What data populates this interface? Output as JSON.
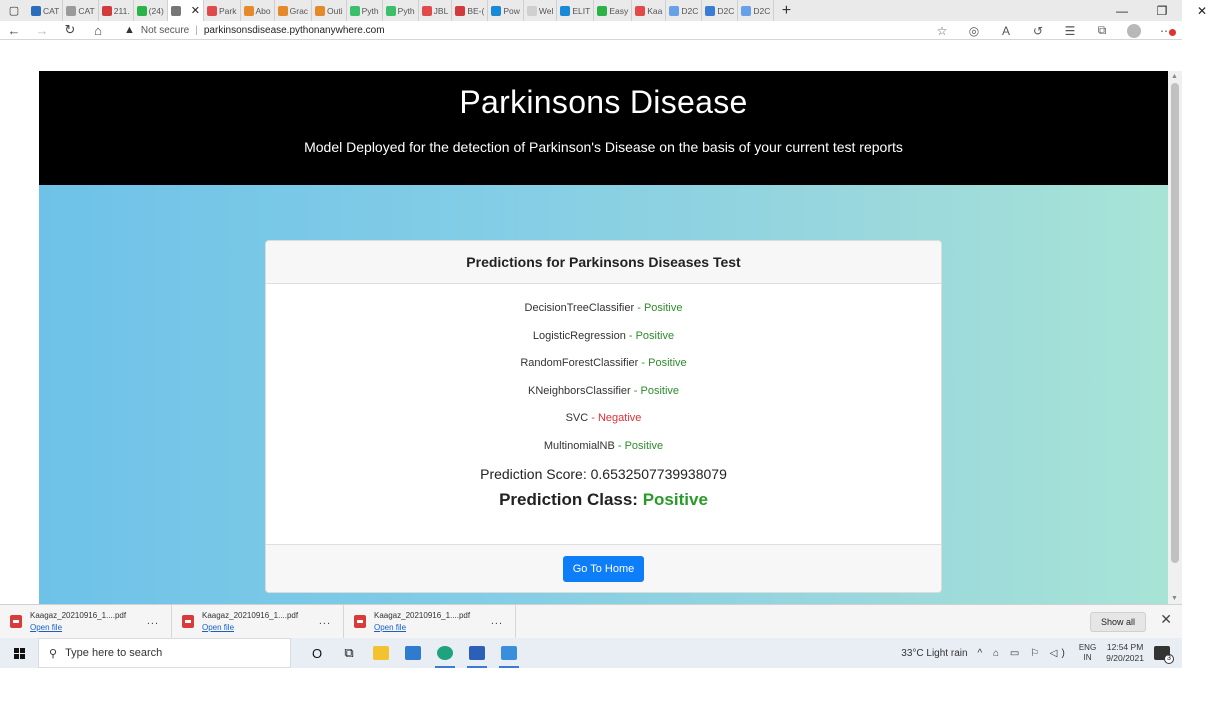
{
  "browser": {
    "tabs": [
      {
        "label": "CAT",
        "color": "#2a6ebb"
      },
      {
        "label": "CAT",
        "color": "#9a9a9a"
      },
      {
        "label": "211.",
        "color": "#d23b3b"
      },
      {
        "label": "(24)",
        "color": "#2bb34a"
      },
      {
        "label": "",
        "color": "#777777",
        "active": true
      },
      {
        "label": "Park",
        "color": "#e04a4a"
      },
      {
        "label": "Abo",
        "color": "#e58a2a"
      },
      {
        "label": "Grac",
        "color": "#e58a2a"
      },
      {
        "label": "Outi",
        "color": "#e58a2a"
      },
      {
        "label": "Pyth",
        "color": "#3cbf6a"
      },
      {
        "label": "Pyth",
        "color": "#3cbf6a"
      },
      {
        "label": "JBL",
        "color": "#e04a4a"
      },
      {
        "label": "BE-(",
        "color": "#d23b3b"
      },
      {
        "label": "Pow",
        "color": "#1a8ad8"
      },
      {
        "label": "Wel",
        "color": "#cfcfcf"
      },
      {
        "label": "ELIT",
        "color": "#1a8ad8"
      },
      {
        "label": "Easy",
        "color": "#2bb34a"
      },
      {
        "label": "Kaa",
        "color": "#e04a4a"
      },
      {
        "label": "D2C",
        "color": "#66a0e8"
      },
      {
        "label": "D2C",
        "color": "#3a7bd5"
      },
      {
        "label": "D2C",
        "color": "#66a0e8"
      }
    ],
    "active_tab_close": "✕",
    "new_tab": "+",
    "window_controls": {
      "minimize": "—",
      "maximize": "❐",
      "close": "✕"
    },
    "address": {
      "warning_icon": "warning-triangle-icon",
      "not_secure": "Not secure",
      "separator": "|",
      "url": "parkinsonsdisease.pythonanywhere.com"
    }
  },
  "page": {
    "title": "Parkinsons Disease",
    "subtitle": "Model Deployed for the detection of Parkinson's Disease on the basis of your current test reports",
    "card": {
      "header": "Predictions for Parkinsons Diseases Test",
      "predictions": [
        {
          "model": "DecisionTreeClassifier",
          "sep": " - ",
          "result": "Positive"
        },
        {
          "model": "LogisticRegression",
          "sep": " - ",
          "result": "Positive"
        },
        {
          "model": "RandomForestClassifier",
          "sep": " - ",
          "result": "Positive"
        },
        {
          "model": "KNeighborsClassifier",
          "sep": " - ",
          "result": "Positive"
        },
        {
          "model": "SVC",
          "sep": " - ",
          "result": "Negative"
        },
        {
          "model": "MultinomialNB",
          "sep": " - ",
          "result": "Positive"
        }
      ],
      "score_label": "Prediction Score: ",
      "score_value": "0.6532507739938079",
      "class_label": "Prediction Class: ",
      "class_value": "Positive",
      "home_button": "Go To Home"
    },
    "colors": {
      "positive": "#2e8b2e",
      "negative": "#e0303a",
      "button": "#0d7ef8"
    }
  },
  "downloads": {
    "items": [
      {
        "name": "Kaagaz_20210916_1....pdf",
        "action": "Open file"
      },
      {
        "name": "Kaagaz_20210916_1....pdf",
        "action": "Open file"
      },
      {
        "name": "Kaagaz_20210916_1....pdf",
        "action": "Open file"
      }
    ],
    "more": "...",
    "show_all": "Show all",
    "close": "✕"
  },
  "taskbar": {
    "search_placeholder": "Type here to search",
    "weather": "33°C  Light rain",
    "tray_symbols": "^ ⌂ ▭ ⚐ ◁)",
    "lang_1": "ENG",
    "lang_2": "IN",
    "time": "12:54 PM",
    "date": "9/20/2021",
    "notifications": "3"
  }
}
